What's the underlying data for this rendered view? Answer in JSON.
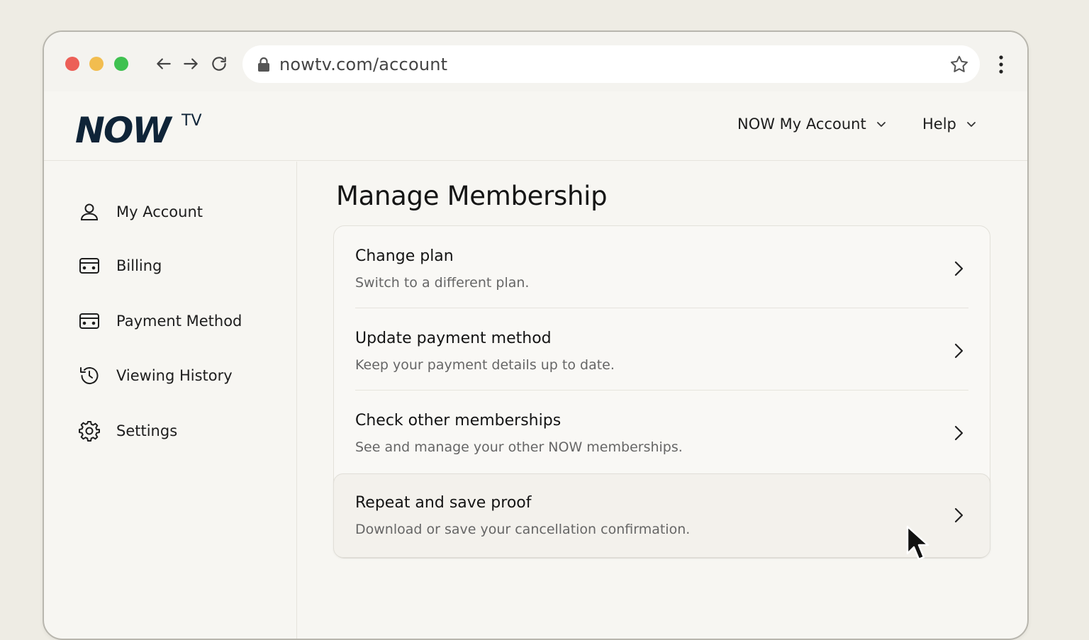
{
  "browser": {
    "url": "nowtv.com/account"
  },
  "header": {
    "logo_text": "NOW",
    "logo_suffix": "TV",
    "nav": [
      {
        "label": "NOW My Account"
      },
      {
        "label": "Help"
      }
    ]
  },
  "sidebar": {
    "items": [
      {
        "label": "My Account",
        "icon": "user-icon"
      },
      {
        "label": "Billing",
        "icon": "billing-card-icon"
      },
      {
        "label": "Payment Method",
        "icon": "payment-card-icon"
      },
      {
        "label": "Viewing History",
        "icon": "history-icon"
      },
      {
        "label": "Settings",
        "icon": "gear-icon"
      }
    ]
  },
  "main": {
    "title": "Manage Membership",
    "options": [
      {
        "title": "Change plan",
        "description": "Switch to a different plan."
      },
      {
        "title": "Update payment method",
        "description": "Keep your payment details up to date."
      },
      {
        "title": "Check other memberships",
        "description": "See and manage your other NOW memberships."
      },
      {
        "title": "Repeat and save proof",
        "description": "Download or save your cancellation confirmation."
      }
    ]
  },
  "colors": {
    "background": "#eeece4",
    "window": "#f7f6f2",
    "text": "#1a1a1a",
    "muted": "#666666",
    "logo": "#0f2438"
  }
}
